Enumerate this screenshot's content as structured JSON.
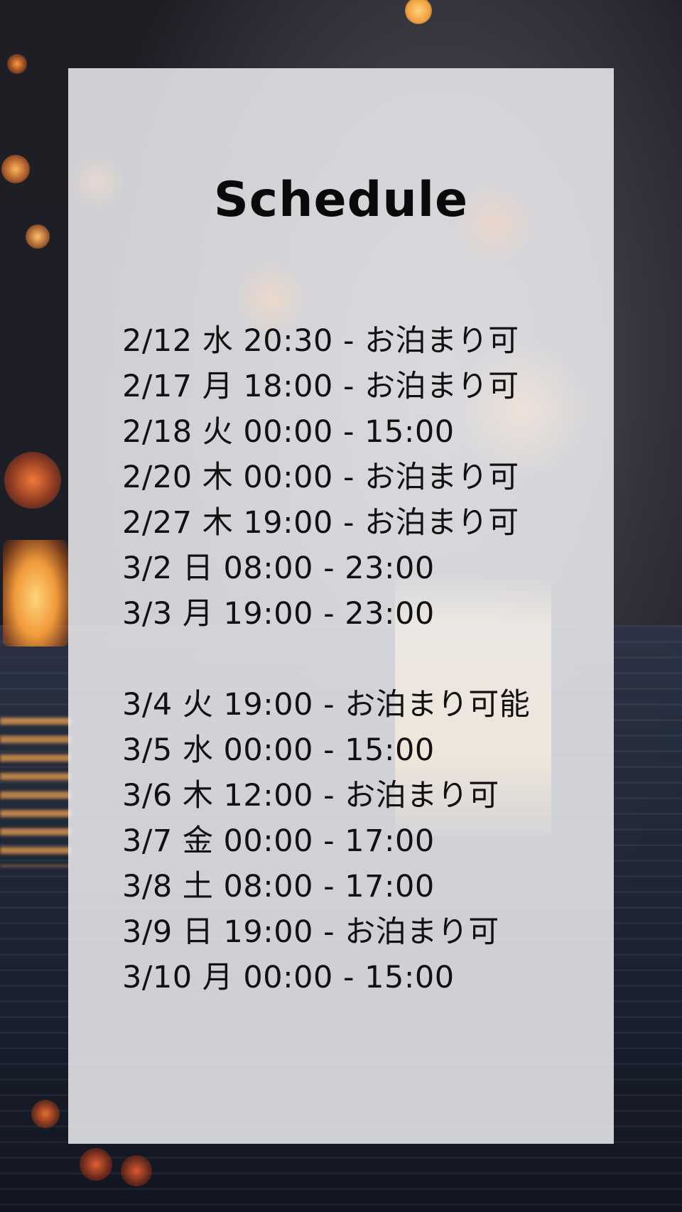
{
  "title": "Schedule",
  "schedule": [
    {
      "text": "2/12 水 20:30 - お泊まり可"
    },
    {
      "text": "2/17 月 18:00 - お泊まり可"
    },
    {
      "text": "2/18 火 00:00 - 15:00"
    },
    {
      "text": "2/20 木 00:00 - お泊まり可"
    },
    {
      "text": "2/27 木 19:00 - お泊まり可"
    },
    {
      "text": "3/2 日 08:00 - 23:00"
    },
    {
      "text": "3/3 月 19:00 - 23:00"
    },
    {
      "text": "3/4 火 19:00 - お泊まり可能"
    },
    {
      "text": "3/5 水 00:00 - 15:00"
    },
    {
      "text": "3/6 木 12:00 - お泊まり可"
    },
    {
      "text": "3/7 金 00:00 - 17:00"
    },
    {
      "text": "3/8 土 08:00 - 17:00"
    },
    {
      "text": "3/9 日 19:00 - お泊まり可"
    },
    {
      "text": "3/10 月 00:00 - 15:00"
    }
  ],
  "colors": {
    "card": "#f2f2f6",
    "text": "#111111",
    "lantern_glow": "#f09a3a"
  }
}
